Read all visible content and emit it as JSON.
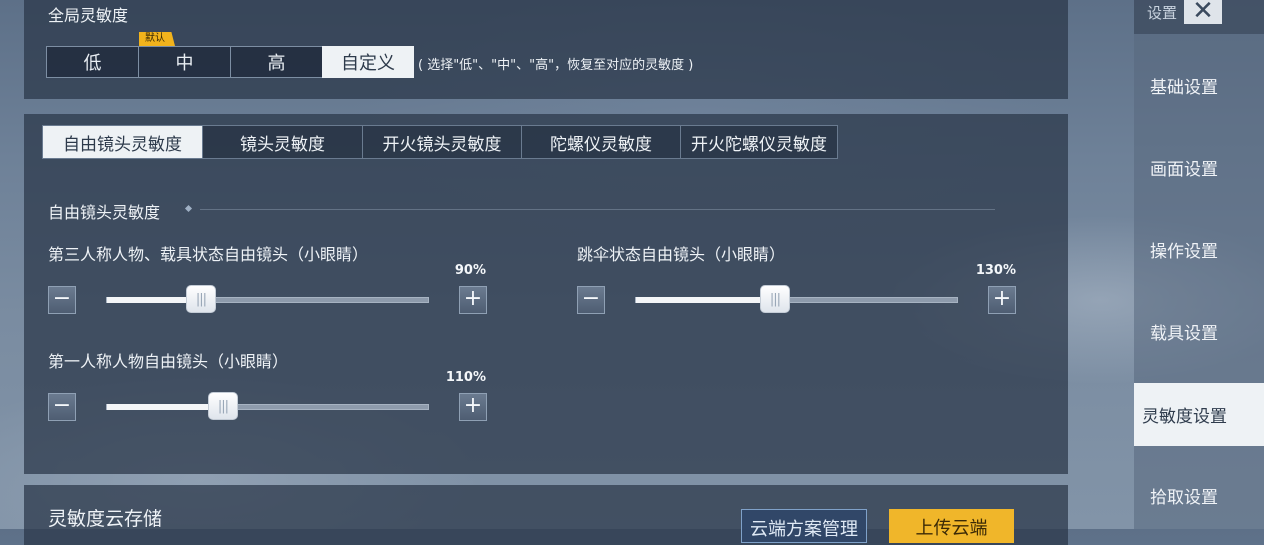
{
  "global": {
    "title": "全局灵敏度",
    "default_badge": "默认",
    "options": [
      "低",
      "中",
      "高",
      "自定义"
    ],
    "selected": "自定义",
    "hint": "( 选择\"低\"、\"中\"、\"高\"，恢复至对应的灵敏度 )"
  },
  "tabs": [
    {
      "label": "自由镜头灵敏度",
      "active": true
    },
    {
      "label": "镜头灵敏度",
      "active": false
    },
    {
      "label": "开火镜头灵敏度",
      "active": false
    },
    {
      "label": "陀螺仪灵敏度",
      "active": false
    },
    {
      "label": "开火陀螺仪灵敏度",
      "active": false
    }
  ],
  "section": {
    "title": "自由镜头灵敏度"
  },
  "sliders": [
    {
      "label": "第三人称人物、载具状态自由镜头（小眼睛）",
      "value_text": "90%",
      "fraction": 0.29
    },
    {
      "label": "跳伞状态自由镜头（小眼睛）",
      "value_text": "130%",
      "fraction": 0.43
    },
    {
      "label": "第一人称人物自由镜头（小眼睛）",
      "value_text": "110%",
      "fraction": 0.36
    }
  ],
  "controls": {
    "minus": "−",
    "plus": "+",
    "thumb_grip": "|||"
  },
  "cloud": {
    "title": "灵敏度云存储",
    "manage_label": "云端方案管理",
    "upload_label": "上传云端"
  },
  "nav": {
    "title": "设置",
    "close": "✕",
    "items": [
      {
        "label": "基础设置",
        "active": false
      },
      {
        "label": "画面设置",
        "active": false
      },
      {
        "label": "操作设置",
        "active": false
      },
      {
        "label": "载具设置",
        "active": false
      },
      {
        "label": "灵敏度设置",
        "active": true
      },
      {
        "label": "拾取设置",
        "active": false
      }
    ]
  }
}
